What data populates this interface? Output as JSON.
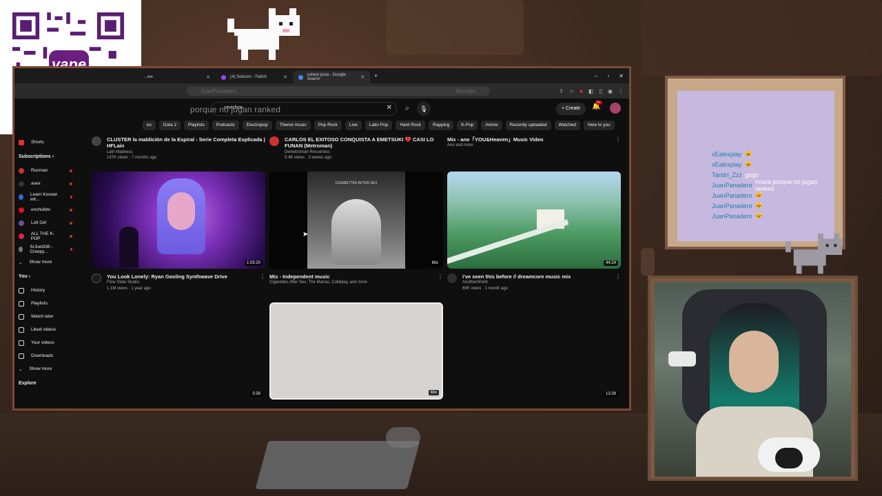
{
  "qr": {
    "brand": "yape"
  },
  "browser": {
    "tabs": [
      {
        "label": "...ew",
        "icon_color": "#444"
      },
      {
        "label": "(4) Solicorn - Twitch",
        "icon_color": "#9146ff"
      },
      {
        "label": "suhein jovia - Google Search",
        "icon_color": "#4285f4"
      }
    ],
    "url_left": "JuanPanadero",
    "url_right": "Muradin",
    "overlay_chat_text": "porque no jugan ranked"
  },
  "youtube": {
    "search_value": "cevichon",
    "create_label": "Create",
    "notification_count": "9+",
    "chips": [
      "es",
      "Dota 2",
      "Playlists",
      "Podcasts",
      "Electropop",
      "Theme music",
      "Pop Rock",
      "Live",
      "Latin Pop",
      "Hard Rock",
      "Rapping",
      "K-Pop",
      "Anime",
      "Recently uploaded",
      "Watched",
      "New to you"
    ],
    "sidebar": {
      "shorts": "Shorts",
      "subscriptions_header": "Subscriptions",
      "subscriptions": [
        {
          "label": "Rusman",
          "color": "#c33"
        },
        {
          "label": "avex",
          "color": "#333"
        },
        {
          "label": "Learn Korean wit...",
          "color": "#2b6cd8"
        },
        {
          "label": "enchufetv",
          "color": "#d12"
        },
        {
          "label": "Lofi Girl",
          "color": "#6a4e9d"
        },
        {
          "label": "ALL THE K-POP",
          "color": "#e0214f"
        },
        {
          "label": "SrJoel336 - Creepy...",
          "color": "#777"
        }
      ],
      "show_more_1": "Show more",
      "you_header": "You",
      "you_items": [
        {
          "label": "History",
          "icon": "history-icon"
        },
        {
          "label": "Playlists",
          "icon": "playlists-icon"
        },
        {
          "label": "Watch later",
          "icon": "watch-later-icon"
        },
        {
          "label": "Liked videos",
          "icon": "liked-icon"
        },
        {
          "label": "Your videos",
          "icon": "your-videos-icon"
        },
        {
          "label": "Downloads",
          "icon": "downloads-icon"
        }
      ],
      "show_more_2": "Show more",
      "explore_header": "Explore"
    },
    "top_row": [
      {
        "title": "CLUSTER la maldición de la Espiral - Serie Completa Explicada | HFLain",
        "channel": "Lain Madness",
        "stats": "147K views · 7 months ago"
      },
      {
        "title": "CARLOS EL EXITOSO CONQUISTA A EMETSUKI 💔 CASI LO FUNAN (Metroman)",
        "channel": "Demetroman Recuerdos",
        "stats": "5.4K views · 3 weeks ago"
      },
      {
        "title": "Mix - ano「YOU&Heaven」Music Video",
        "channel": "Ano and more",
        "stats": ""
      }
    ],
    "videos": [
      {
        "title": "You Look Lonely: Ryan Gosling Synthwave Drive",
        "channel": "Flow State Studio",
        "stats": "1.1M views · 1 year ago",
        "duration": "1:03:20"
      },
      {
        "title": "Mix - Independent music",
        "channel": "Cigarettes After Sex, The Marías, Coldplay, and more",
        "stats": "",
        "duration": "Mix",
        "thumb_text": "CIGARETTES AFTER SEX"
      },
      {
        "title": "i've seen this before // dreamcore music mix",
        "channel": "AnotherWorld",
        "stats": "69K views · 1 month ago",
        "duration": "44:24"
      }
    ],
    "bottom_durations": [
      "5:58",
      "Mix",
      "13:39"
    ]
  },
  "chat": {
    "messages": [
      {
        "user": "xEalexplay",
        "msg": "😺"
      },
      {
        "user": "xEalexplay",
        "msg": "😺"
      },
      {
        "user": "Tandri_Zzz",
        "msg": "gogo"
      },
      {
        "user": "JuanPanadero",
        "msg": "!mura porque no jugan ranked"
      },
      {
        "user": "JuanPanadero",
        "msg": "🐱"
      },
      {
        "user": "JuanPanadero",
        "msg": "🐱"
      },
      {
        "user": "JuanPanadero",
        "msg": "🐱"
      }
    ]
  }
}
